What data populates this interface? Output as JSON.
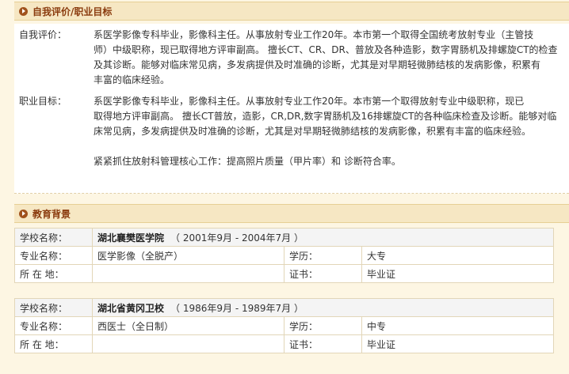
{
  "self_eval": {
    "header": "自我评价/职业目标",
    "eval_label": "自我评价：",
    "eval_lines": [
      "系医学影像专科毕业，影像科主任。从事放射专业工作20年。本市第一个取得全国统考放射专业（主管技",
      "师）中级职称，现已取得地方评审副高。 擅长CT、CR、DR、普放及各种造影，数字胃肠机及排螺旋CT的检查",
      "及其诊断。能够对临床常见病，多发病提供及时准确的诊断，尤其是对早期轻微肺结核的发病影像，积累有",
      "丰富的临床经验。"
    ],
    "goal_label": "职业目标：",
    "goal_lines": [
      "系医学影像专科毕业，影像科主任。从事放射专业工作20年。本市第一个取得放射专业中级职称，现已",
      "取得地方评审副高。 擅长CT普放，造影，CR,DR,数字胃肠机及16排螺旋CT的各种临床检查及诊断。能够对临",
      "床常见病，多发病提供及时准确的诊断，尤其是对早期轻微肺结核的发病影像，积累有丰富的临床经验。"
    ],
    "goal_extra": "紧紧抓住放射科管理核心工作：提高照片质量（甲片率）和 诊断符合率。"
  },
  "education": {
    "header": "教育背景",
    "labels": {
      "school": "学校名称：",
      "major": "专业名称：",
      "degree": "学历：",
      "location": "所 在 地：",
      "certificate": "证书："
    },
    "entries": [
      {
        "school": "湖北襄樊医学院",
        "period": "（ 2001年9月 - 2004年7月 ）",
        "major": "医学影像（全脱产）",
        "degree": "大专",
        "location": "",
        "certificate": "毕业证"
      },
      {
        "school": "湖北省黄冈卫校",
        "period": "（ 1986年9月 - 1989年7月 ）",
        "major": "西医士（全日制）",
        "degree": "中专",
        "location": "",
        "certificate": "毕业证"
      }
    ]
  }
}
